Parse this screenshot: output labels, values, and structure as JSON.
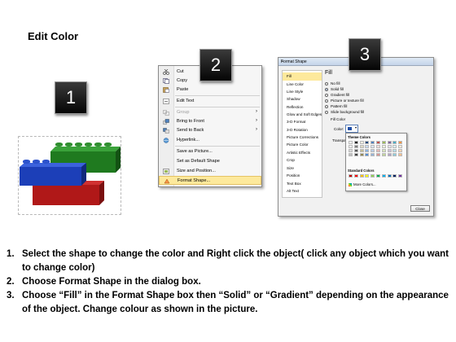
{
  "slide": {
    "title": "Edit Color",
    "steps": [
      "1",
      "2",
      "3"
    ]
  },
  "context_menu": {
    "items": [
      {
        "label": "Cut",
        "icon": "scissors-icon",
        "submenu": false,
        "disabled": false,
        "highlighted": false
      },
      {
        "label": "Copy",
        "icon": "copy-icon",
        "submenu": false,
        "disabled": false,
        "highlighted": false
      },
      {
        "label": "Paste",
        "icon": "paste-icon",
        "submenu": false,
        "disabled": false,
        "highlighted": false
      },
      {
        "label": "Edit Text",
        "icon": "edit-text-icon",
        "submenu": false,
        "disabled": false,
        "highlighted": false
      },
      {
        "label": "Group",
        "icon": "group-icon",
        "submenu": true,
        "disabled": true,
        "highlighted": false
      },
      {
        "label": "Bring to Front",
        "icon": "bring-front-icon",
        "submenu": true,
        "disabled": false,
        "highlighted": false
      },
      {
        "label": "Send to Back",
        "icon": "send-back-icon",
        "submenu": true,
        "disabled": false,
        "highlighted": false
      },
      {
        "label": "Hyperlink...",
        "icon": "hyperlink-icon",
        "submenu": false,
        "disabled": false,
        "highlighted": false
      },
      {
        "label": "Save as Picture...",
        "icon": "",
        "submenu": false,
        "disabled": false,
        "highlighted": false
      },
      {
        "label": "Set as Default Shape",
        "icon": "",
        "submenu": false,
        "disabled": false,
        "highlighted": false
      },
      {
        "label": "Size and Position...",
        "icon": "size-position-icon",
        "submenu": false,
        "disabled": false,
        "highlighted": false
      },
      {
        "label": "Format Shape...",
        "icon": "format-shape-icon",
        "submenu": false,
        "disabled": false,
        "highlighted": true
      }
    ]
  },
  "format_dialog": {
    "title": "Format Shape",
    "categories": [
      "Fill",
      "Line Color",
      "Line Style",
      "Shadow",
      "Reflection",
      "Glow and Soft Edges",
      "3-D Format",
      "3-D Rotation",
      "Picture Corrections",
      "Picture Color",
      "Artistic Effects",
      "Crop",
      "Size",
      "Position",
      "Text Box",
      "Alt Text"
    ],
    "selected_category": "Fill",
    "panel_heading": "Fill",
    "fill_options": [
      {
        "label": "No fill",
        "selected": false
      },
      {
        "label": "Solid fill",
        "selected": true
      },
      {
        "label": "Gradient fill",
        "selected": false
      },
      {
        "label": "Picture or texture fill",
        "selected": false
      },
      {
        "label": "Pattern fill",
        "selected": false
      },
      {
        "label": "Slide background fill",
        "selected": false
      }
    ],
    "fill_color_label": "Fill Color",
    "color_label": "Color:",
    "transparency_label": "Transpar",
    "close_button": "Close",
    "palette": {
      "theme_heading": "Theme Colors",
      "standard_heading": "Standard Colors",
      "more_colors": "More Colors...",
      "theme_row": [
        "#ffffff",
        "#000000",
        "#eeece1",
        "#1f497d",
        "#4f81bd",
        "#c0504d",
        "#9bbb59",
        "#8064a2",
        "#4bacc6",
        "#f79646"
      ],
      "standard_row": [
        "#c00000",
        "#ff0000",
        "#ffc000",
        "#ffff00",
        "#92d050",
        "#00b050",
        "#00b0f0",
        "#0070c0",
        "#002060",
        "#7030a0"
      ]
    }
  },
  "instructions": [
    {
      "num": "1.",
      "text": "Select the shape to change the color and Right click the object( click any object which you want to change color)"
    },
    {
      "num": "2.",
      "text": "Choose Format Shape in the dialog box."
    },
    {
      "num": "3.",
      "text": "Choose “Fill” in the Format Shape box then “Solid” or “Gradient” depending on the appearance of the object. Change colour as shown in the picture."
    }
  ],
  "colors": {
    "brick_green": "#1f7a1f",
    "brick_blue": "#1c3fb8",
    "brick_red": "#b01818",
    "menu_highlight": "#fde99c"
  }
}
